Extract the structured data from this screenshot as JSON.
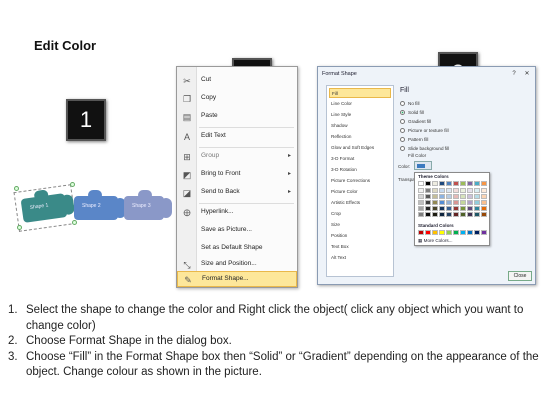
{
  "title": "Edit Color",
  "badges": [
    "1",
    "2",
    "3"
  ],
  "hands": [
    {
      "label": "Shape 1",
      "color": "#3a8a88"
    },
    {
      "label": "Shape 2",
      "color": "#5a86c8"
    },
    {
      "label": "Shape 3",
      "color": "#8a98c8"
    }
  ],
  "context_menu": {
    "items": [
      {
        "label": "Cut",
        "icon": "scissors-icon",
        "submenu": false
      },
      {
        "label": "Copy",
        "icon": "copy-icon",
        "submenu": false
      },
      {
        "label": "Paste",
        "icon": "paste-icon",
        "submenu": false
      },
      {
        "label": "Edit Text",
        "icon": "edit-text-icon",
        "submenu": false
      },
      {
        "label": "Group",
        "icon": "group-icon",
        "submenu": true
      },
      {
        "label": "Bring to Front",
        "icon": "bring-front-icon",
        "submenu": true
      },
      {
        "label": "Send to Back",
        "icon": "send-back-icon",
        "submenu": true
      },
      {
        "label": "Hyperlink...",
        "icon": "hyperlink-icon",
        "submenu": false
      },
      {
        "label": "Save as Picture...",
        "icon": "",
        "submenu": false
      },
      {
        "label": "Set as Default Shape",
        "icon": "",
        "submenu": false
      },
      {
        "label": "Size and Position...",
        "icon": "size-icon",
        "submenu": false
      },
      {
        "label": "Format Shape...",
        "icon": "format-icon",
        "submenu": false
      }
    ]
  },
  "dialog": {
    "title": "Format Shape",
    "nav": [
      "Fill",
      "Line Color",
      "Line Style",
      "Shadow",
      "Reflection",
      "Glow and Soft Edges",
      "3-D Format",
      "3-D Rotation",
      "Picture Corrections",
      "Picture Color",
      "Artistic Effects",
      "Crop",
      "Size",
      "Position",
      "Text Box",
      "Alt Text"
    ],
    "panel_title": "Fill",
    "fill_options": [
      "No fill",
      "Solid fill",
      "Gradient fill",
      "Picture or texture fill",
      "Pattern fill",
      "Slide background fill"
    ],
    "fill_color_label": "Fill Color",
    "color_label": "Color:",
    "transparency_label": "Transpar",
    "theme_colors_label": "Theme Colors",
    "standard_colors_label": "Standard Colors",
    "more_colors_label": "More Colors...",
    "close_label": "Close"
  },
  "palette": {
    "theme_rows": [
      [
        "#ffffff",
        "#000000",
        "#eeece1",
        "#1f497d",
        "#4f81bd",
        "#c0504d",
        "#9bbb59",
        "#8064a2",
        "#4bacc6",
        "#f79646"
      ],
      [
        "#f2f2f2",
        "#7f7f7f",
        "#ddd9c3",
        "#c6d9f0",
        "#dbe5f1",
        "#f2dcdb",
        "#ebf1dd",
        "#e5e0ec",
        "#dbeef3",
        "#fdeada"
      ],
      [
        "#d8d8d8",
        "#595959",
        "#c4bd97",
        "#8db3e2",
        "#b8cce4",
        "#e5b9b7",
        "#d7e3bc",
        "#ccc1d9",
        "#b7dde8",
        "#fbd5b5"
      ],
      [
        "#bfbfbf",
        "#3f3f3f",
        "#938953",
        "#548dd4",
        "#95b3d7",
        "#d99694",
        "#c3d69b",
        "#b2a2c7",
        "#92cddc",
        "#fac08f"
      ],
      [
        "#a5a5a5",
        "#262626",
        "#494429",
        "#17365d",
        "#366092",
        "#953734",
        "#76923c",
        "#5f497a",
        "#31859b",
        "#e36c09"
      ],
      [
        "#7f7f7f",
        "#0c0c0c",
        "#1d1b10",
        "#0f243e",
        "#244061",
        "#632423",
        "#4f6128",
        "#3f3151",
        "#205867",
        "#974806"
      ]
    ],
    "standard": [
      "#c00000",
      "#ff0000",
      "#ffc000",
      "#ffff00",
      "#92d050",
      "#00b050",
      "#00b0f0",
      "#0070c0",
      "#002060",
      "#7030a0"
    ]
  },
  "instructions": [
    {
      "num": "1.",
      "text": "Select the shape to change the color and Right click the object( click any object which you want to change color)"
    },
    {
      "num": "2.",
      "text": "Choose Format Shape in the dialog box."
    },
    {
      "num": "3.",
      "text": "Choose “Fill” in the Format Shape box then “Solid” or “Gradient” depending on the appearance of the object. Change colour as shown in the picture."
    }
  ]
}
